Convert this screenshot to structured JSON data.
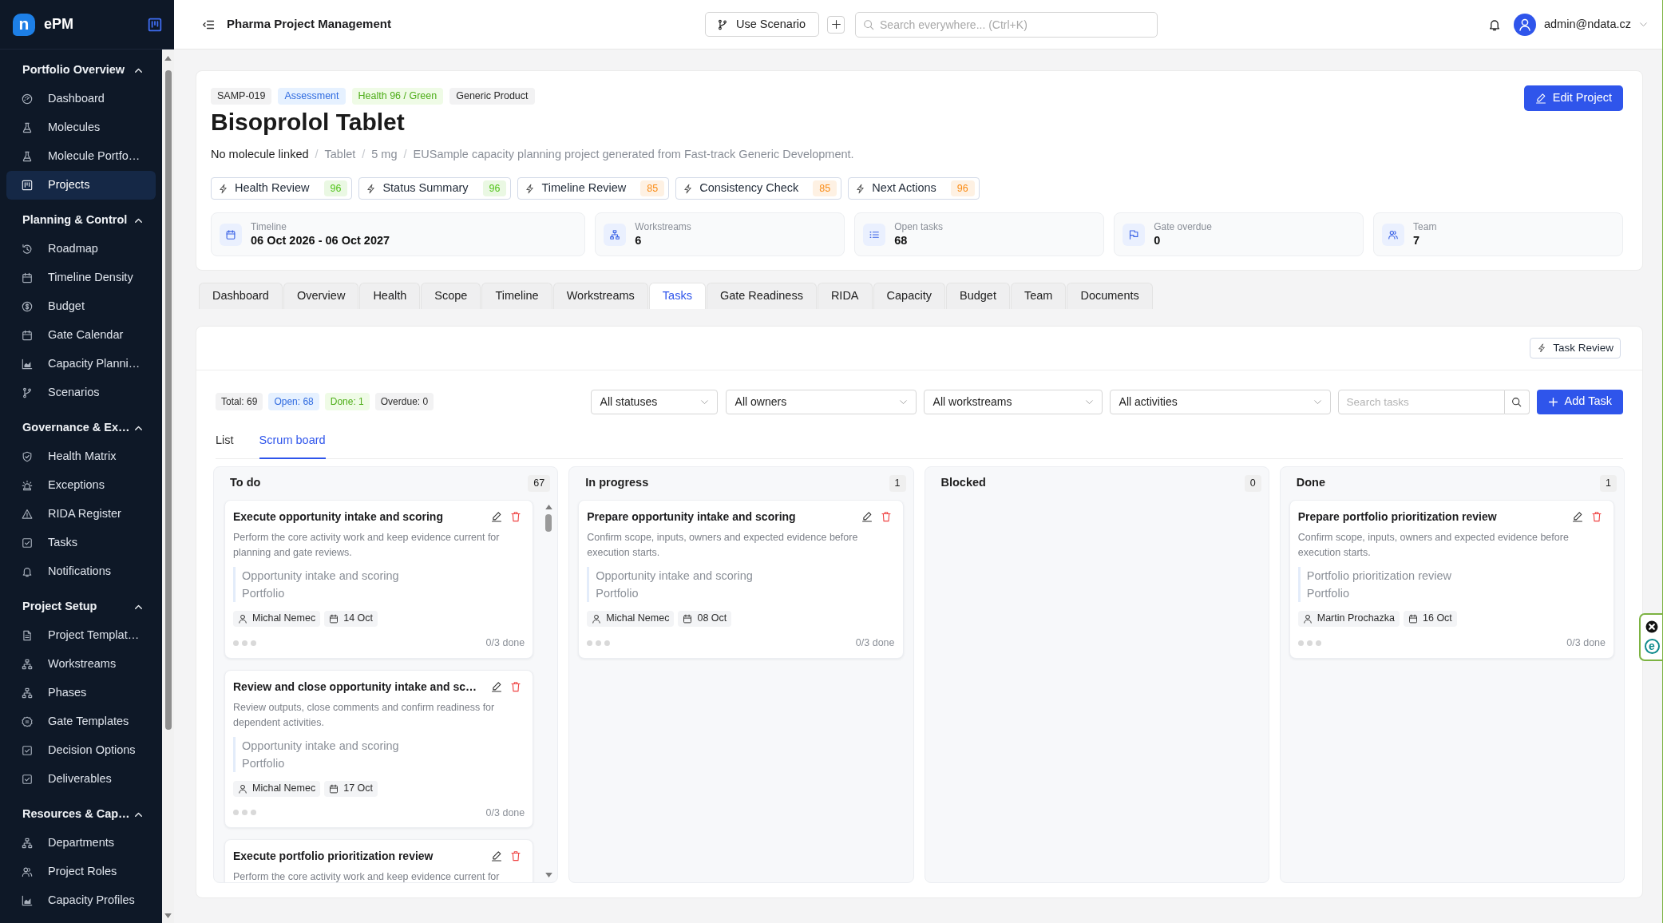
{
  "sidebar": {
    "logo_mark": "n",
    "app_name": "ePM",
    "sections": [
      {
        "title": "Portfolio Overview",
        "expanded": true,
        "items": [
          {
            "label": "Dashboard",
            "selected": false
          },
          {
            "label": "Molecules",
            "selected": false
          },
          {
            "label": "Molecule Portfo…",
            "selected": false
          },
          {
            "label": "Projects",
            "selected": true
          }
        ]
      },
      {
        "title": "Planning & Control",
        "expanded": true,
        "items": [
          {
            "label": "Roadmap",
            "selected": false
          },
          {
            "label": "Timeline Density",
            "selected": false
          },
          {
            "label": "Budget",
            "selected": false
          },
          {
            "label": "Gate Calendar",
            "selected": false
          },
          {
            "label": "Capacity Planni…",
            "selected": false
          },
          {
            "label": "Scenarios",
            "selected": false
          }
        ]
      },
      {
        "title": "Governance & Ex…",
        "expanded": true,
        "items": [
          {
            "label": "Health Matrix",
            "selected": false
          },
          {
            "label": "Exceptions",
            "selected": false
          },
          {
            "label": "RIDA Register",
            "selected": false
          },
          {
            "label": "Tasks",
            "selected": false
          },
          {
            "label": "Notifications",
            "selected": false
          }
        ]
      },
      {
        "title": "Project Setup",
        "expanded": true,
        "items": [
          {
            "label": "Project Templat…",
            "selected": false
          },
          {
            "label": "Workstreams",
            "selected": false
          },
          {
            "label": "Phases",
            "selected": false
          },
          {
            "label": "Gate Templates",
            "selected": false
          },
          {
            "label": "Decision Options",
            "selected": false
          },
          {
            "label": "Deliverables",
            "selected": false
          }
        ]
      },
      {
        "title": "Resources & Cap…",
        "expanded": true,
        "items": [
          {
            "label": "Departments",
            "selected": false
          },
          {
            "label": "Project Roles",
            "selected": false
          },
          {
            "label": "Capacity Profiles",
            "selected": false
          }
        ]
      }
    ]
  },
  "header": {
    "title": "Pharma Project Management",
    "scenario_button": "Use Scenario",
    "search": {
      "placeholder": "Search everywhere... (Ctrl+K)"
    },
    "user": "admin@ndata.cz"
  },
  "project": {
    "tags": [
      {
        "label": "SAMP-019",
        "kind": "neutral"
      },
      {
        "label": "Assessment",
        "kind": "info"
      },
      {
        "label": "Health 96 / Green",
        "kind": "success"
      },
      {
        "label": "Generic Product",
        "kind": "neutral"
      }
    ],
    "title": "Bisoprolol Tablet",
    "edit_button": "Edit Project",
    "meta": [
      {
        "kind": "primary",
        "text": "No molecule linked"
      },
      {
        "kind": "separator",
        "text": "/"
      },
      {
        "kind": "secondary",
        "text": "Tablet"
      },
      {
        "kind": "separator",
        "text": "/"
      },
      {
        "kind": "secondary",
        "text": "5 mg"
      },
      {
        "kind": "separator",
        "text": "/"
      },
      {
        "kind": "secondary",
        "text": "EUSample capacity planning project generated from Fast-track Generic Development."
      }
    ],
    "reviews": [
      {
        "label": "Health Review",
        "score": "96",
        "color": "#52c41a"
      },
      {
        "label": "Status Summary",
        "score": "96",
        "color": "#52c41a"
      },
      {
        "label": "Timeline Review",
        "score": "85",
        "color": "#fa8c16"
      },
      {
        "label": "Consistency Check",
        "score": "85",
        "color": "#fa8c16"
      },
      {
        "label": "Next Actions",
        "score": "96",
        "color": "#fa8c16"
      }
    ],
    "stats": [
      {
        "label": "Timeline",
        "value": "06 Oct 2026 - 06 Oct 2027"
      },
      {
        "label": "Workstreams",
        "value": "6"
      },
      {
        "label": "Open tasks",
        "value": "68"
      },
      {
        "label": "Gate overdue",
        "value": "0"
      },
      {
        "label": "Team",
        "value": "7"
      }
    ]
  },
  "tabs": [
    {
      "label": "Dashboard",
      "selected": false
    },
    {
      "label": "Overview",
      "selected": false
    },
    {
      "label": "Health",
      "selected": false
    },
    {
      "label": "Scope",
      "selected": false
    },
    {
      "label": "Timeline",
      "selected": false
    },
    {
      "label": "Workstreams",
      "selected": false
    },
    {
      "label": "Tasks",
      "selected": true
    },
    {
      "label": "Gate Readiness",
      "selected": false
    },
    {
      "label": "RIDA",
      "selected": false
    },
    {
      "label": "Capacity",
      "selected": false
    },
    {
      "label": "Budget",
      "selected": false
    },
    {
      "label": "Team",
      "selected": false
    },
    {
      "label": "Documents",
      "selected": false
    }
  ],
  "tasks": {
    "review_button": "Task Review",
    "counts": [
      {
        "label": "Total: 69",
        "kind": "neutral"
      },
      {
        "label": "Open: 68",
        "kind": "info"
      },
      {
        "label": "Done: 1",
        "kind": "success"
      },
      {
        "label": "Overdue: 0",
        "kind": "neutral"
      }
    ],
    "filters": [
      {
        "value": "All statuses"
      },
      {
        "value": "All owners"
      },
      {
        "value": "All workstreams"
      },
      {
        "value": "All activities"
      }
    ],
    "search": {
      "placeholder": "Search tasks"
    },
    "add_button": "Add Task",
    "views": [
      {
        "label": "List",
        "selected": false
      },
      {
        "label": "Scrum board",
        "selected": true
      }
    ],
    "columns": [
      {
        "title": "To do",
        "count": "67",
        "cards": [
          {
            "title": "Execute opportunity intake and scoring",
            "description": "Perform the core activity work and keep evidence current for planning and gate reviews.",
            "activity": "Opportunity intake and scoring",
            "workstream": "Portfolio",
            "owner": "Michal Nemec",
            "due": "14 Oct",
            "checklist": [
              {
                "done": false
              },
              {
                "done": false
              },
              {
                "done": false
              }
            ],
            "progress": "0/3 done"
          },
          {
            "title": "Review and close opportunity intake and sc…",
            "description": "Review outputs, close comments and confirm readiness for dependent activities.",
            "activity": "Opportunity intake and scoring",
            "workstream": "Portfolio",
            "owner": "Michal Nemec",
            "due": "17 Oct",
            "checklist": [
              {
                "done": false
              },
              {
                "done": false
              },
              {
                "done": false
              }
            ],
            "progress": "0/3 done"
          },
          {
            "title": "Execute portfolio prioritization review",
            "description": "Perform the core activity work and keep evidence current for"
          }
        ]
      },
      {
        "title": "In progress",
        "count": "1",
        "cards": [
          {
            "title": "Prepare opportunity intake and scoring",
            "description": "Confirm scope, inputs, owners and expected evidence before execution starts.",
            "activity": "Opportunity intake and scoring",
            "workstream": "Portfolio",
            "owner": "Michal Nemec",
            "due": "08 Oct",
            "checklist": [
              {
                "done": false
              },
              {
                "done": false
              },
              {
                "done": false
              }
            ],
            "progress": "0/3 done"
          }
        ]
      },
      {
        "title": "Blocked",
        "count": "0"
      },
      {
        "title": "Done",
        "count": "1",
        "cards": [
          {
            "title": "Prepare portfolio prioritization review",
            "description": "Confirm scope, inputs, owners and expected evidence before execution starts.",
            "activity": "Portfolio prioritization review",
            "workstream": "Portfolio",
            "owner": "Martin Prochazka",
            "due": "16 Oct",
            "checklist": [
              {
                "done": false
              },
              {
                "done": false
              },
              {
                "done": false
              }
            ],
            "progress": "0/3 done"
          }
        ]
      }
    ]
  },
  "extension_widget": {
    "label": "e"
  }
}
